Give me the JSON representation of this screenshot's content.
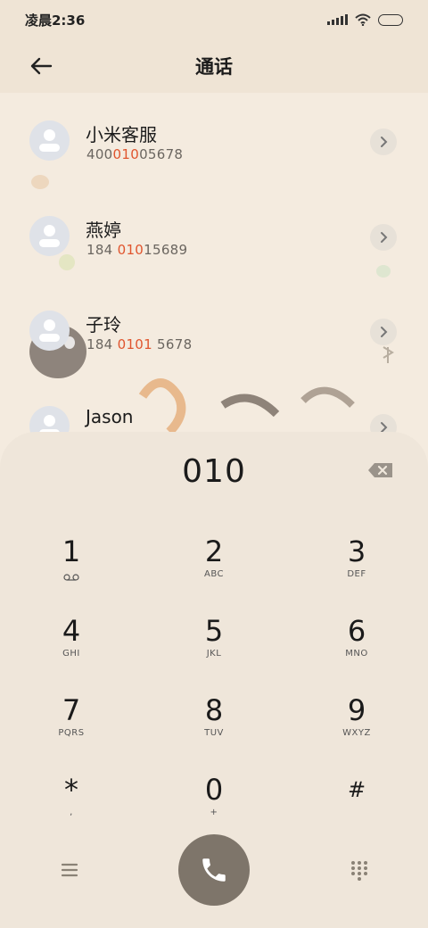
{
  "status": {
    "time": "凌晨2:36"
  },
  "header": {
    "title": "通话",
    "back_icon": "arrow-left-icon"
  },
  "contacts": [
    {
      "name": "小米客服",
      "num_pre": "400",
      "num_hl": "010",
      "num_post": "05678"
    },
    {
      "name": "燕婷",
      "num_pre": "184 ",
      "num_hl": "010",
      "num_post": "15689"
    },
    {
      "name": "子玲",
      "num_pre": "184 ",
      "num_hl": "0101",
      "num_post": " 5678"
    },
    {
      "name": "Jason",
      "num_pre": "",
      "num_hl": "",
      "num_post": ""
    }
  ],
  "dialer": {
    "input": "010",
    "keys": [
      {
        "digit": "1",
        "letters": ""
      },
      {
        "digit": "2",
        "letters": "ABC"
      },
      {
        "digit": "3",
        "letters": "DEF"
      },
      {
        "digit": "4",
        "letters": "GHI"
      },
      {
        "digit": "5",
        "letters": "JKL"
      },
      {
        "digit": "6",
        "letters": "MNO"
      },
      {
        "digit": "7",
        "letters": "PQRS"
      },
      {
        "digit": "8",
        "letters": "TUV"
      },
      {
        "digit": "9",
        "letters": "WXYZ"
      },
      {
        "digit": "*",
        "letters": ","
      },
      {
        "digit": "0",
        "letters": "+"
      },
      {
        "digit": "#",
        "letters": ""
      }
    ]
  },
  "colors": {
    "highlight": "#e0552e",
    "call_button": "#7e756a",
    "background": "#f4ebdf"
  }
}
